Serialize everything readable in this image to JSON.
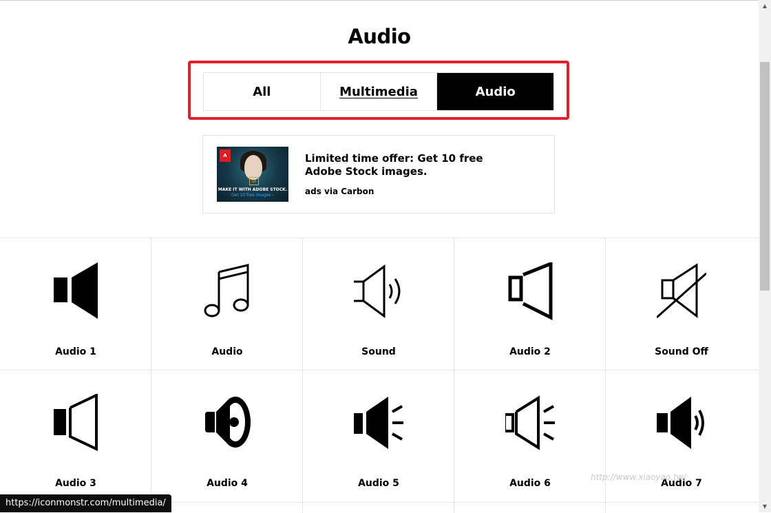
{
  "page": {
    "title": "Audio"
  },
  "tabs": [
    {
      "label": "All"
    },
    {
      "label": "Multimedia"
    },
    {
      "label": "Audio"
    }
  ],
  "ad": {
    "headline": "Limited time offer: Get 10 free Adobe Stock images.",
    "via": "ads via Carbon",
    "image_logo": "Adobe",
    "image_st": "St",
    "image_caption": "MAKE IT WITH ADOBE STOCK.",
    "image_subcaption": "Get 10 free images ›"
  },
  "icons": [
    {
      "label": "Audio 1",
      "icon": "speaker-filled-icon"
    },
    {
      "label": "Audio",
      "icon": "music-note-icon"
    },
    {
      "label": "Sound",
      "icon": "speaker-outline-waves-icon"
    },
    {
      "label": "Audio 2",
      "icon": "speaker-outline-bold-icon"
    },
    {
      "label": "Sound Off",
      "icon": "speaker-muted-icon"
    },
    {
      "label": "Audio 3",
      "icon": "speaker-half-outline-icon"
    },
    {
      "label": "Audio 4",
      "icon": "speaker-cone-icon"
    },
    {
      "label": "Audio 5",
      "icon": "speaker-filled-rays-icon"
    },
    {
      "label": "Audio 6",
      "icon": "speaker-outline-rays-icon"
    },
    {
      "label": "Audio 7",
      "icon": "speaker-filled-waves-icon"
    }
  ],
  "status_bar": {
    "url": "https://iconmonstr.com/multimedia/"
  },
  "watermark": {
    "text": "http://www.xiaoyao.tw/"
  }
}
